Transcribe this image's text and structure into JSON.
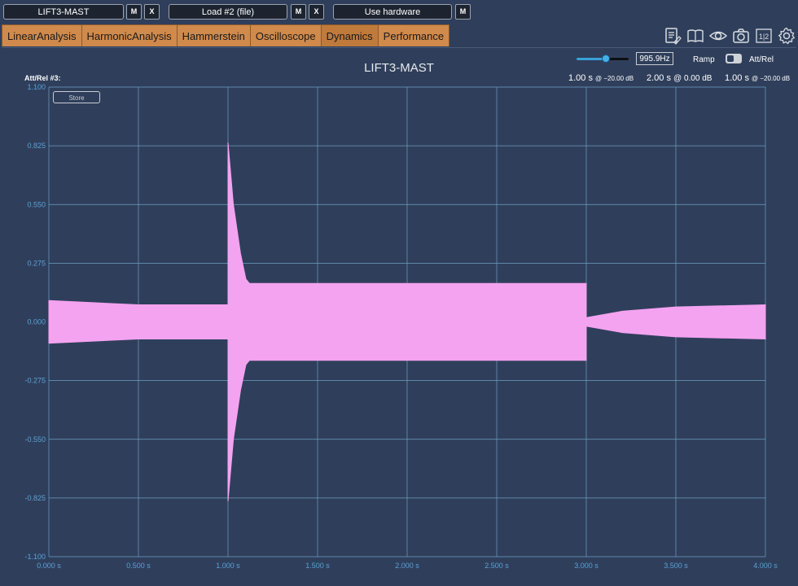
{
  "topbar": {
    "slot1": {
      "label": "LIFT3-MAST",
      "m": "M",
      "x": "X"
    },
    "slot2": {
      "label": "Load #2 (file)",
      "m": "M",
      "x": "X"
    },
    "slot3": {
      "label": "Use hardware",
      "m": "M"
    }
  },
  "tabs": [
    "LinearAnalysis",
    "HarmonicAnalysis",
    "Hammerstein",
    "Oscilloscope",
    "Dynamics",
    "Performance"
  ],
  "active_tab": "Dynamics",
  "toolbar_icons": [
    "notes-icon",
    "book-icon",
    "eye-icon",
    "camera-icon",
    "split-icon",
    "gear-icon"
  ],
  "toolbar_split_text": "1|2",
  "plot": {
    "title": "LIFT3-MAST",
    "attrel_label": "Att/Rel #3:",
    "frequency": "995.9Hz",
    "ramp_label": "Ramp",
    "attrel_toggle_label": "Att/Rel",
    "store_label": "Store",
    "segments": [
      {
        "time": "1.00 s",
        "level": "@ −20.00 dB"
      },
      {
        "time": "2.00 s",
        "level": "@ 0.00 dB"
      },
      {
        "time": "1.00 s",
        "level": "@ −20.00 dB"
      }
    ],
    "waveform_color": "#f4a3f0"
  },
  "chart_data": {
    "type": "area",
    "title": "LIFT3-MAST",
    "xlabel": "",
    "ylabel": "",
    "xlim": [
      0,
      4
    ],
    "ylim": [
      -1.1,
      1.1
    ],
    "grid": true,
    "x_tick_labels": [
      "0.000 s",
      "0.500 s",
      "1.000 s",
      "1.500 s",
      "2.000 s",
      "2.500 s",
      "3.000 s",
      "3.500 s",
      "4.000 s"
    ],
    "y_tick_labels": [
      "1.100",
      "0.825",
      "0.550",
      "0.275",
      "0.000",
      "-0.275",
      "-0.550",
      "-0.825",
      "-1.100"
    ],
    "series": [
      {
        "envelope_upper": [
          [
            0,
            0.1
          ],
          [
            0.5,
            0.08
          ],
          [
            1.0,
            0.08
          ],
          [
            1.0,
            0.84
          ],
          [
            1.03,
            0.55
          ],
          [
            1.07,
            0.32
          ],
          [
            1.1,
            0.2
          ],
          [
            1.12,
            0.18
          ],
          [
            1.5,
            0.18
          ],
          [
            2.0,
            0.18
          ],
          [
            3.0,
            0.18
          ],
          [
            3.0,
            0.02
          ],
          [
            3.2,
            0.05
          ],
          [
            3.5,
            0.07
          ],
          [
            4.0,
            0.08
          ]
        ],
        "envelope_lower": [
          [
            0,
            -0.1
          ],
          [
            0.5,
            -0.08
          ],
          [
            1.0,
            -0.08
          ],
          [
            1.0,
            -0.84
          ],
          [
            1.03,
            -0.55
          ],
          [
            1.07,
            -0.32
          ],
          [
            1.1,
            -0.2
          ],
          [
            1.12,
            -0.18
          ],
          [
            1.5,
            -0.18
          ],
          [
            2.0,
            -0.18
          ],
          [
            3.0,
            -0.18
          ],
          [
            3.0,
            -0.02
          ],
          [
            3.2,
            -0.05
          ],
          [
            3.5,
            -0.07
          ],
          [
            4.0,
            -0.08
          ]
        ]
      }
    ]
  }
}
